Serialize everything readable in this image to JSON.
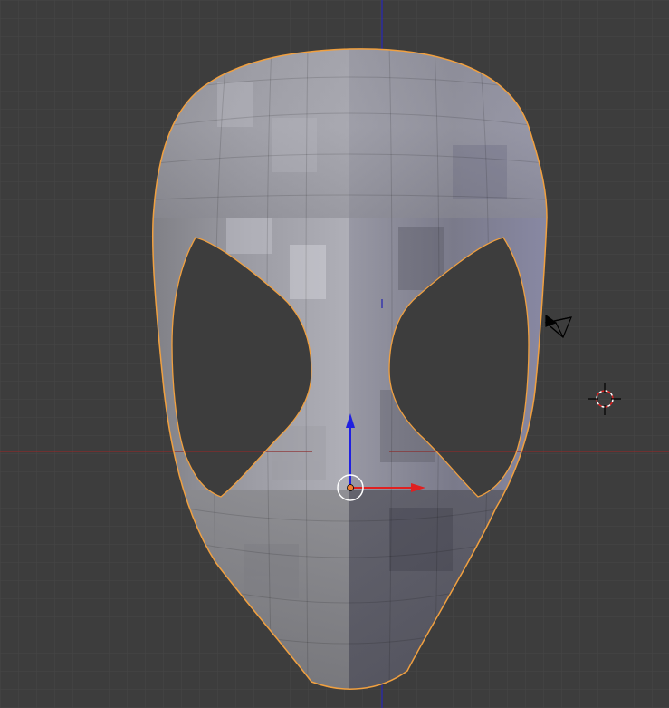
{
  "viewport": {
    "background": "#3d3d3d",
    "grid_color": "#474747",
    "axis_x_color": "#8c2b2b",
    "axis_z_color": "#2a2ab0"
  },
  "mesh": {
    "icon": "spider-mask-mesh",
    "selection_outline_color": "#f0a040",
    "base_color": "#8c8c96"
  },
  "gizmo": {
    "icon": "translate-gizmo",
    "x_arrow_color": "#e02020",
    "z_arrow_color": "#2020e0",
    "origin_color": "#f08030"
  },
  "camera": {
    "icon": "camera-icon"
  },
  "cursor_3d": {
    "icon": "3d-cursor-icon"
  }
}
